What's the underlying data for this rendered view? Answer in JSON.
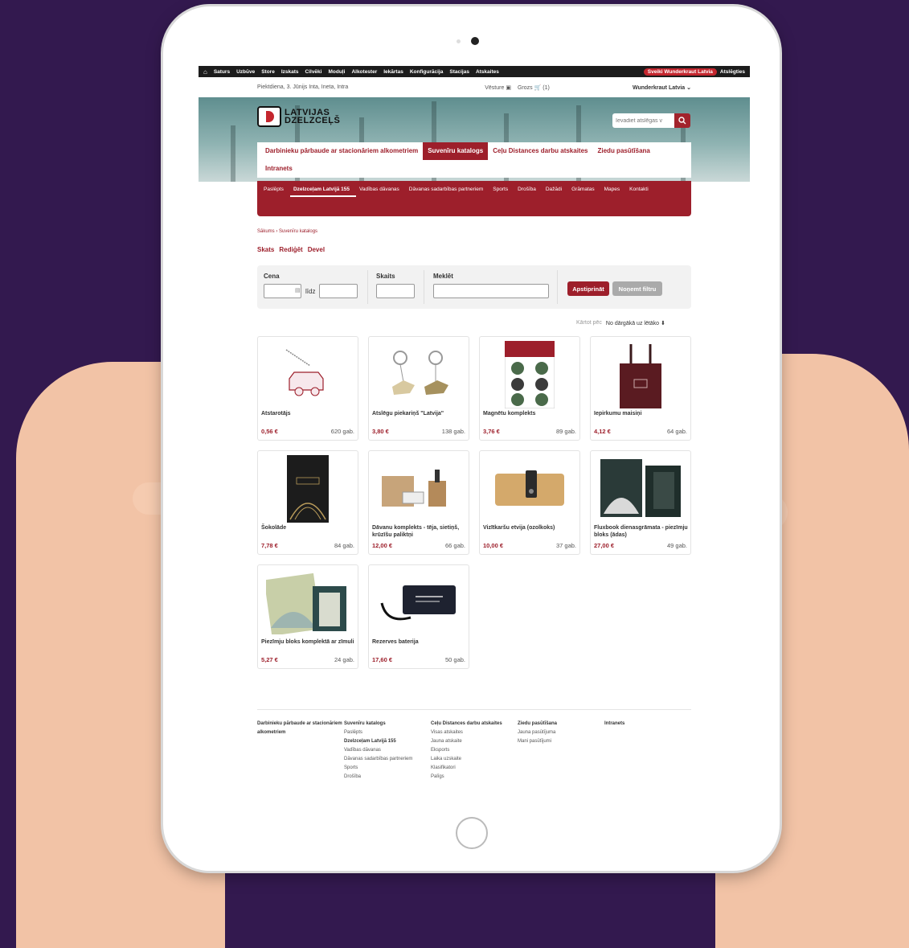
{
  "admin_bar": {
    "menu": [
      "Saturs",
      "Uzbūve",
      "Store",
      "Izskats",
      "Cilvēki",
      "Moduļi",
      "Alkotester",
      "Iekārtas",
      "Konfigurācija",
      "Stacijas",
      "Atskaites"
    ],
    "greeting": "Sveiki Wunderkraut Latvia",
    "logout": "Atslēgties"
  },
  "top_strip": {
    "date": "Piektdiena, 3. Jūnijs  Inta, Ineta, Intra",
    "history": "Vēsture",
    "cart": "Grozs",
    "cart_count": "(1)",
    "account": "Wunderkraut Latvia ⌄"
  },
  "brand": {
    "line1": "LATVIJAS",
    "line2": "DZELZCEĻŠ"
  },
  "search": {
    "placeholder": "Ievadiet atslēgas v"
  },
  "main_nav": [
    "Darbinieku pārbaude ar stacionāriem alkometriem",
    "Suvenīru katalogs",
    "Ceļu Distances darbu atskaites",
    "Ziedu pasūtīšana",
    "Intranets"
  ],
  "sub_nav": [
    "Paslēpts",
    "Dzelzceļam Latvijā 155",
    "Vadības dāvanas",
    "Dāvanas sadarbības partneriem",
    "Sports",
    "Drošība",
    "Dažādi",
    "Grāmatas",
    "Mapes",
    "Kontakti"
  ],
  "breadcrumb": "Sākums › Suvenīru katalogs",
  "tabs": [
    "Skats",
    "Rediģēt",
    "Devel"
  ],
  "filter": {
    "price_label": "Cena",
    "to_label": "līdz",
    "count_label": "Skaits",
    "search_label": "Meklēt",
    "apply": "Apstiprināt",
    "clear": "Noņemt filtru"
  },
  "sort": {
    "label": "Kārtot pēc",
    "value": "No dārgākā uz lētāko ⬇"
  },
  "products": [
    {
      "name": "Atstarotājs",
      "price": "0,56 €",
      "stock": "620 gab."
    },
    {
      "name": "Atslēgu piekariņš \"Latvija\"",
      "price": "3,80 €",
      "stock": "138 gab."
    },
    {
      "name": "Magnētu komplekts",
      "price": "3,76 €",
      "stock": "89 gab."
    },
    {
      "name": "Iepirkumu maisiņi",
      "price": "4,12 €",
      "stock": "64 gab."
    },
    {
      "name": "Šokolāde",
      "price": "7,78 €",
      "stock": "84 gab."
    },
    {
      "name": "Dāvanu komplekts - tēja, sietiņš, krūzīšu paliktņi",
      "price": "12,00 €",
      "stock": "66 gab."
    },
    {
      "name": "Vizītkaršu etvija (ozolkoks)",
      "price": "10,00 €",
      "stock": "37 gab."
    },
    {
      "name": "Fluxbook dienasgrāmata - piezīmju bloks (ādas)",
      "price": "27,00 €",
      "stock": "49 gab."
    },
    {
      "name": "Piezīmju bloks komplektā ar zīmuli",
      "price": "5,27 €",
      "stock": "24 gab."
    },
    {
      "name": "Rezerves baterija",
      "price": "17,60 €",
      "stock": "50 gab."
    }
  ],
  "footer": {
    "col1": {
      "head": "Darbinieku pārbaude ar stacionāriem alkometriem"
    },
    "col2": {
      "head": "Suvenīru katalogs",
      "links": [
        "Paslēpts",
        "Dzelzceļam Latvijā 155",
        "Vadības dāvanas",
        "Dāvanas sadarbības partneriem",
        "Sports",
        "Drošība"
      ]
    },
    "col3": {
      "head": "Ceļu Distances darbu atskaites",
      "links": [
        "Visas atskaites",
        "Jauna atskaite",
        "Eksports",
        "Laika uzskaite",
        "Klasifikatori",
        "Palīgs"
      ]
    },
    "col4": {
      "head": "Ziedu pasūtīšana",
      "links": [
        "Jauna pasūtījuma",
        "Mani pasūtījumi"
      ]
    },
    "col5": {
      "head": "Intranets"
    }
  },
  "colors": {
    "brand_red": "#9d1f2b",
    "background": "#33194f"
  }
}
